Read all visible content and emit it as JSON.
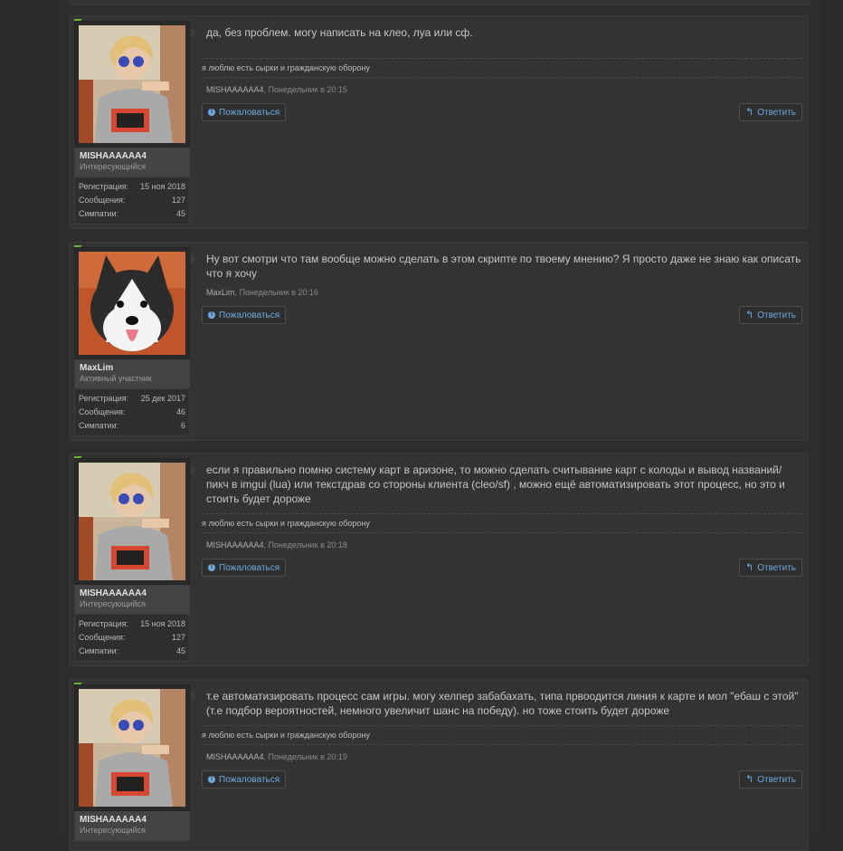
{
  "labels": {
    "report": "Пожаловаться",
    "reply": "Ответить",
    "reg": "Регистрация:",
    "msgs": "Сообщения:",
    "likes": "Симпатии:"
  },
  "posts": [
    {
      "author": "MISHAAAAAA4",
      "user_title": "Интересующийся",
      "reg_date": "15 ноя 2018",
      "messages": "127",
      "likes": "45",
      "text": "да, без проблем. могу написать на клео, луа или сф.",
      "signature": "я люблю есть сырки и гражданскую оборону",
      "meta_author": "MISHAAAAAA4",
      "meta_time": ", Понедельник в 20:15",
      "avatar_icon": "girl-avatar-icon"
    },
    {
      "author": "MaxLim",
      "user_title": "Активный участник",
      "reg_date": "25 дек 2017",
      "messages": "46",
      "likes": "6",
      "text": "Ну вот смотри что там вообще можно сделать в этом скрипте по твоему мнению? Я просто даже не знаю как описать что я хочу",
      "signature": "",
      "meta_author": "MaxLim",
      "meta_time": ", Понедельник в 20:16",
      "avatar_icon": "husky-dog-avatar-icon"
    },
    {
      "author": "MISHAAAAAA4",
      "user_title": "Интересующийся",
      "reg_date": "15 ноя 2018",
      "messages": "127",
      "likes": "45",
      "text": "если я правильно помню систему карт в аризоне, то можно сделать считывание карт с колоды и вывод названий/пикч в imgui (lua) или текстдрав со стороны клиента (cleo/sf) , можно ещё автоматизировать этот процесс, но это и стоить будет дороже",
      "signature": "я люблю есть сырки и гражданскую оборону",
      "meta_author": "MISHAAAAAA4",
      "meta_time": ", Понедельник в 20:18",
      "avatar_icon": "girl-avatar-icon"
    },
    {
      "author": "MISHAAAAAA4",
      "user_title": "Интересующийся",
      "reg_date": "",
      "messages": "",
      "likes": "",
      "text": "т.е автоматизировать процесс сам игры. могу хелпер забабахать, типа првоодится линия к карте и мол \"ебаш с этой\" (т.е подбор вероятностей, немного увеличит шанс на победу). но тоже стоить будет дороже",
      "signature": "я люблю есть сырки и гражданскую оборону",
      "meta_author": "MISHAAAAAA4",
      "meta_time": ", Понедельник в 20:19",
      "avatar_icon": "girl-avatar-icon"
    }
  ]
}
